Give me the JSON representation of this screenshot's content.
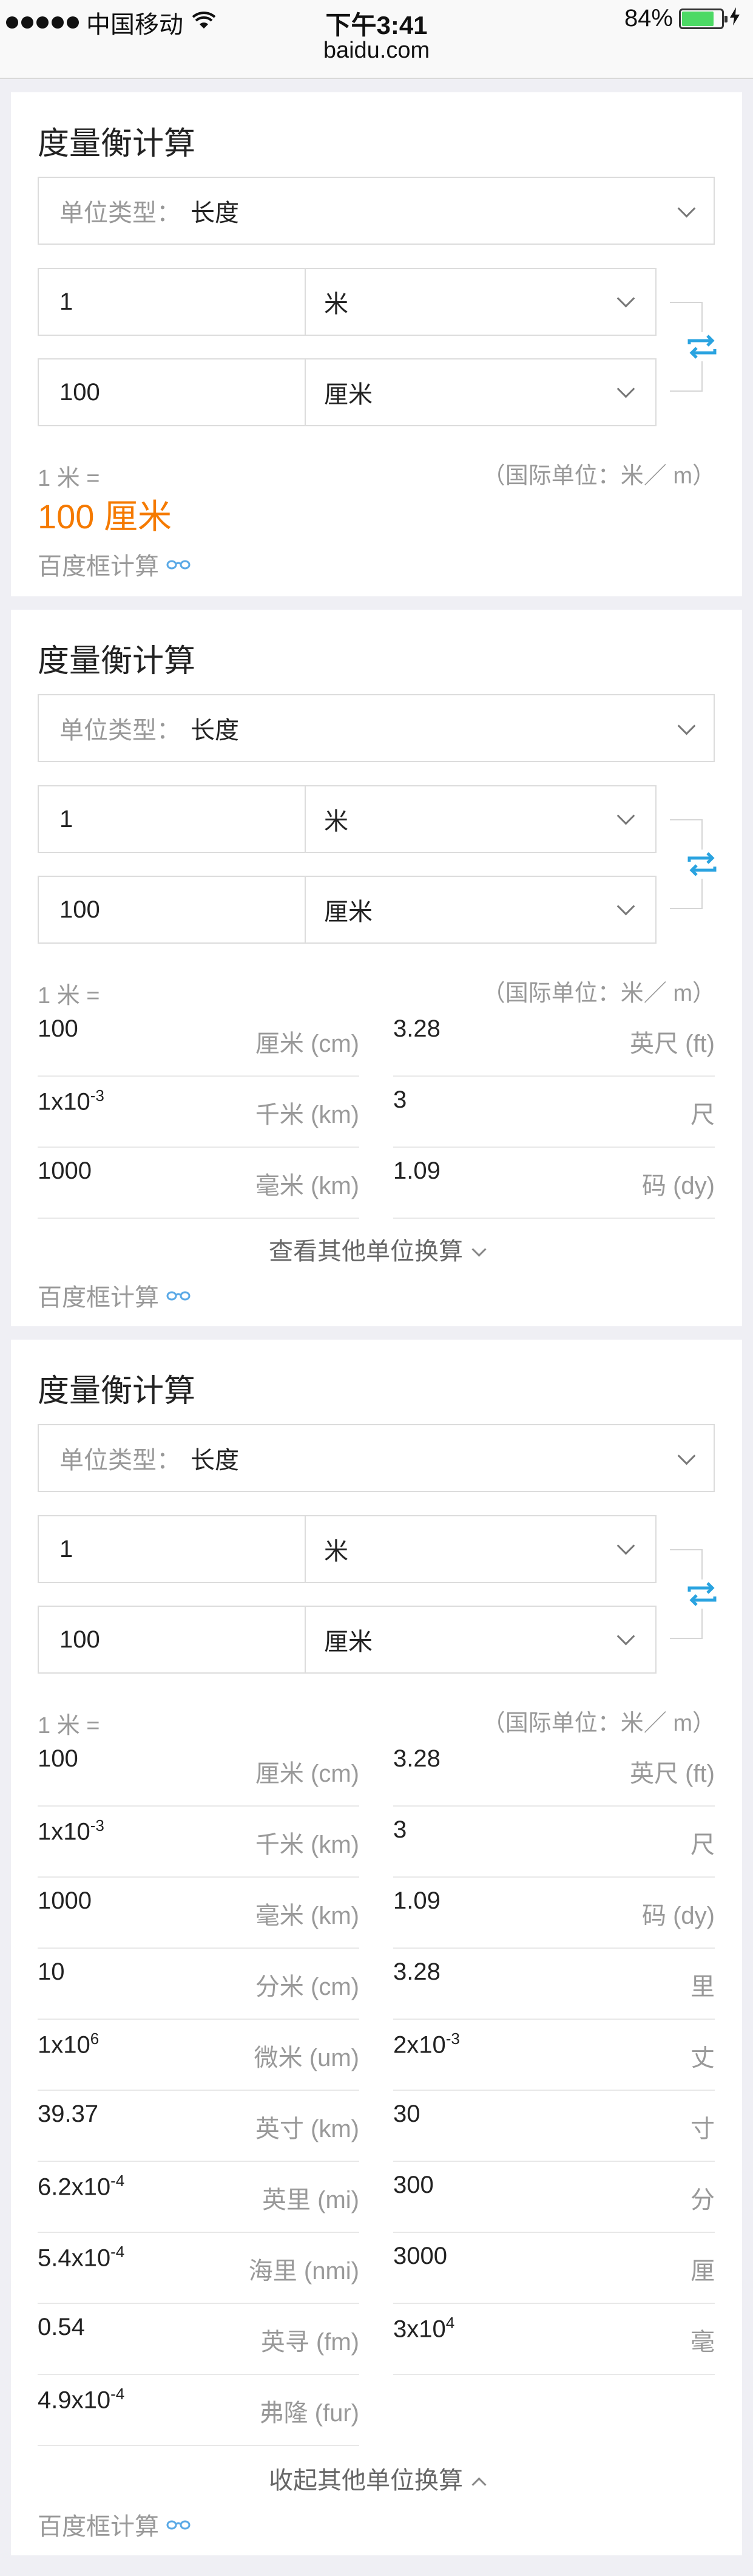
{
  "status_bar": {
    "carrier": "中国移动",
    "time": "下午3:41",
    "battery_percent": "84%",
    "battery_level": 0.84,
    "url": "baidu.com"
  },
  "colors": {
    "accent": "#f57a00",
    "swap": "#2aa3e0",
    "muted": "#999999"
  },
  "cards": [
    {
      "title": "度量衡计算",
      "unit_type_label": "单位类型：",
      "unit_type_value": "长度",
      "from_value": "1",
      "from_unit": "米",
      "to_value": "100",
      "to_unit": "厘米",
      "equation": "1 米 =",
      "intl_unit": "（国际单位：米／ m）",
      "result": "100 厘米",
      "calc_link": "百度框计算"
    },
    {
      "title": "度量衡计算",
      "unit_type_label": "单位类型：",
      "unit_type_value": "长度",
      "from_value": "1",
      "from_unit": "米",
      "to_value": "100",
      "to_unit": "厘米",
      "equation": "1 米 =",
      "intl_unit": "（国际单位：米／ m）",
      "more_label": "查看其他单位换算",
      "calc_link": "百度框计算",
      "rows": [
        {
          "lv": "100",
          "le": "",
          "lu": "厘米 (cm)",
          "rv": "3.28",
          "re": "",
          "ru": "英尺 (ft)"
        },
        {
          "lv": "1x10",
          "le": "-3",
          "lu": "千米 (km)",
          "rv": "3",
          "re": "",
          "ru": "尺"
        },
        {
          "lv": "1000",
          "le": "",
          "lu": "毫米 (km)",
          "rv": "1.09",
          "re": "",
          "ru": "码 (dy)"
        }
      ]
    },
    {
      "title": "度量衡计算",
      "unit_type_label": "单位类型：",
      "unit_type_value": "长度",
      "from_value": "1",
      "from_unit": "米",
      "to_value": "100",
      "to_unit": "厘米",
      "equation": "1 米 =",
      "intl_unit": "（国际单位：米／ m）",
      "less_label": "收起其他单位换算",
      "calc_link": "百度框计算",
      "rows": [
        {
          "lv": "100",
          "le": "",
          "lu": "厘米 (cm)",
          "rv": "3.28",
          "re": "",
          "ru": "英尺 (ft)"
        },
        {
          "lv": "1x10",
          "le": "-3",
          "lu": "千米 (km)",
          "rv": "3",
          "re": "",
          "ru": "尺"
        },
        {
          "lv": "1000",
          "le": "",
          "lu": "毫米 (km)",
          "rv": "1.09",
          "re": "",
          "ru": "码 (dy)"
        },
        {
          "lv": "10",
          "le": "",
          "lu": "分米 (cm)",
          "rv": "3.28",
          "re": "",
          "ru": "里"
        },
        {
          "lv": "1x10",
          "le": "6",
          "lu": "微米 (um)",
          "rv": "2x10",
          "re": "-3",
          "ru": "丈"
        },
        {
          "lv": "39.37",
          "le": "",
          "lu": "英寸 (km)",
          "rv": "30",
          "re": "",
          "ru": "寸"
        },
        {
          "lv": "6.2x10",
          "le": "-4",
          "lu": "英里 (mi)",
          "rv": "300",
          "re": "",
          "ru": "分"
        },
        {
          "lv": "5.4x10",
          "le": "-4",
          "lu": "海里 (nmi)",
          "rv": "3000",
          "re": "",
          "ru": "厘"
        },
        {
          "lv": "0.54",
          "le": "",
          "lu": "英寻 (fm)",
          "rv": "3x10",
          "re": "4",
          "ru": "毫"
        },
        {
          "lv": "4.9x10",
          "le": "-4",
          "lu": "弗隆 (fur)",
          "rv": "",
          "re": "",
          "ru": ""
        }
      ]
    }
  ]
}
